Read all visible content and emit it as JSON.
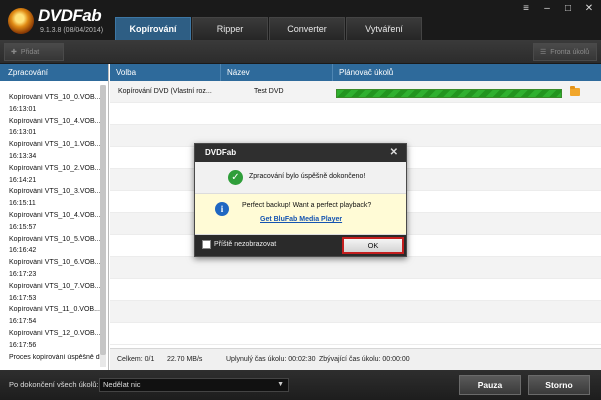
{
  "app": {
    "name": "DVDFab",
    "version": "9.1.3.8 (08/04/2014)"
  },
  "tabs": [
    {
      "label": "Kopírování",
      "active": true
    },
    {
      "label": "Ripper",
      "active": false
    },
    {
      "label": "Converter",
      "active": false
    },
    {
      "label": "Vytváření",
      "active": false
    }
  ],
  "window_controls": {
    "menu": "≡",
    "minimize": "–",
    "maximize": "□",
    "close": "✕"
  },
  "toolbar": {
    "add_label": "Přidat",
    "queue_label": "Fronta úkolů"
  },
  "left_panel": {
    "header": "Zpracování",
    "log": [
      "Kopírování VTS_10_0.VOB...",
      "16:13:01",
      "Kopírování VTS_10_4.VOB...",
      "16:13:01",
      "Kopírování VTS_10_1.VOB...",
      "16:13:34",
      "Kopírování VTS_10_2.VOB...",
      "16:14:21",
      "Kopírování VTS_10_3.VOB...",
      "16:15:11",
      "Kopírování VTS_10_4.VOB...",
      "16:15:57",
      "Kopírování VTS_10_5.VOB...",
      "16:16:42",
      "Kopírování VTS_10_6.VOB...",
      "16:17:23",
      "Kopírování VTS_10_7.VOB...",
      "16:17:53",
      "Kopírování VTS_11_0.VOB...",
      "16:17:54",
      "Kopírování VTS_12_0.VOB...",
      "16:17:56",
      "Proces kopírování úspěšně dokončen"
    ]
  },
  "table": {
    "columns": [
      "Volba",
      "Název",
      "Plánovač úkolů"
    ],
    "rows": [
      {
        "option": "Kopírování DVD (Vlastní roz...",
        "name": "Test DVD",
        "progress": 1.0
      }
    ]
  },
  "status": {
    "total": "Celkem: 0/1",
    "speed": "22.70 MB/s",
    "elapsed": "Uplynulý čas úkolu: 00:02:30",
    "remaining": "Zbývající čas úkolu: 00:00:00"
  },
  "bottom": {
    "after_label": "Po dokončení všech úkolů:",
    "after_value": "Nedělat nic",
    "pause_label": "Pauza",
    "stop_label": "Storno"
  },
  "dialog": {
    "title": "DVDFab",
    "close": "✕",
    "message": "Zpracování bylo úspěšně dokončeno!",
    "ad_text": "Perfect backup! Want a perfect playback?",
    "ad_link": "Get BluFab Media Player",
    "checkbox_label": "Příště nezobrazovat",
    "ok_label": "OK"
  }
}
